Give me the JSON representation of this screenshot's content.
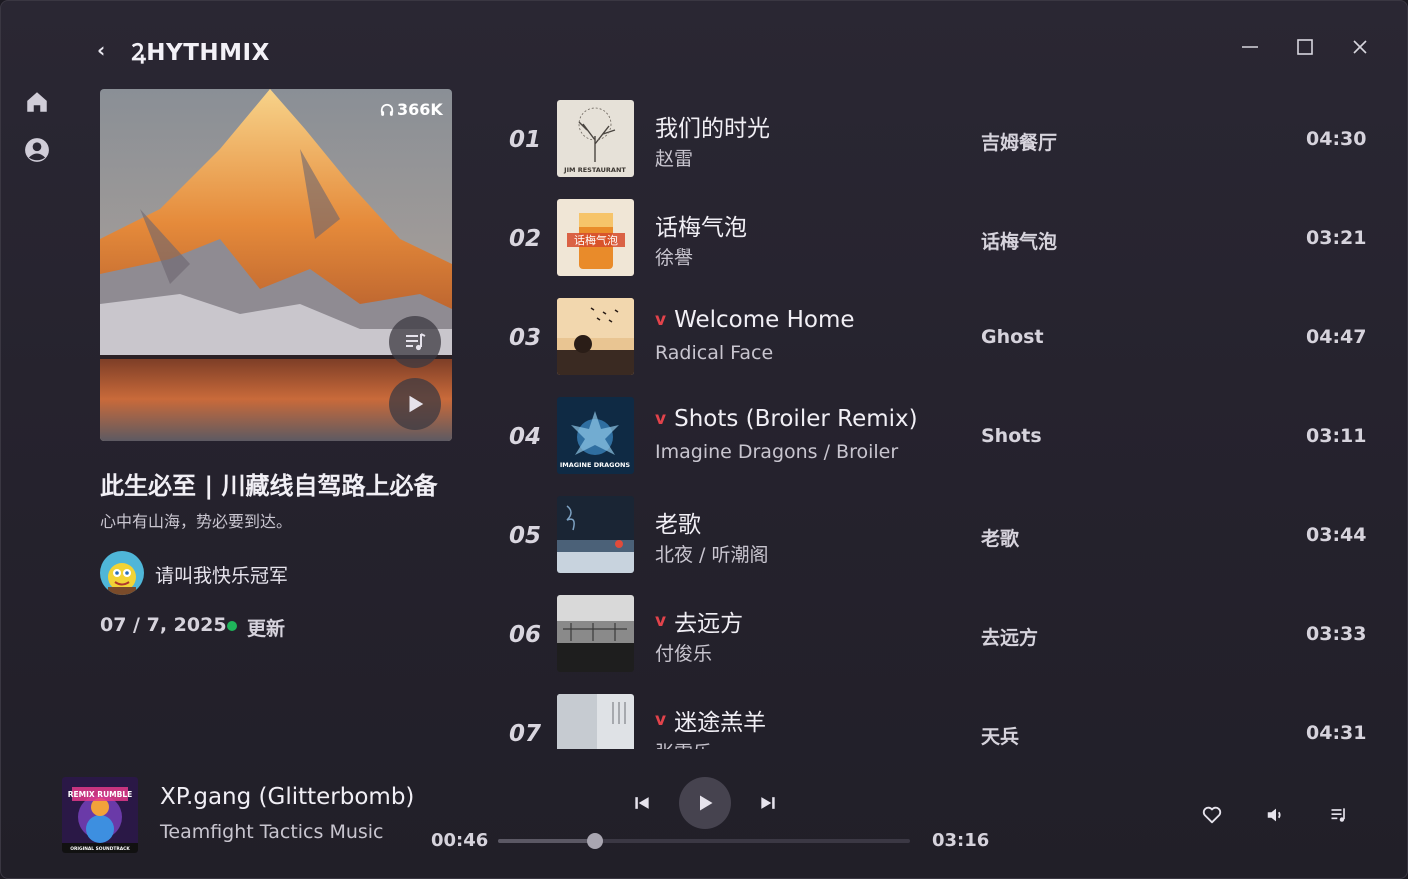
{
  "header": {
    "brand": "ꝜHYTHMIX",
    "back_glyph": "‹"
  },
  "playlist": {
    "listens": "366K",
    "title": "此生必至 | 川藏线自驾路上必备",
    "subtitle": "心中有山海，势必要到达。",
    "owner": "请叫我快乐冠军",
    "date": "07 / 7, 2025",
    "update_label": "更新"
  },
  "songs": [
    {
      "index": "01",
      "title": "我们的时光",
      "artist": "赵雷",
      "album": "吉姆餐厅",
      "duration": "04:30",
      "liked": false
    },
    {
      "index": "02",
      "title": "话梅气泡",
      "artist": "徐譽",
      "album": "话梅气泡",
      "duration": "03:21",
      "liked": false
    },
    {
      "index": "03",
      "title": "Welcome Home",
      "artist": "Radical Face",
      "album": "Ghost",
      "duration": "04:47",
      "liked": true
    },
    {
      "index": "04",
      "title": "Shots (Broiler Remix)",
      "artist": "Imagine Dragons / Broiler",
      "album": "Shots",
      "duration": "03:11",
      "liked": true
    },
    {
      "index": "05",
      "title": "老歌",
      "artist": "北夜 / 听潮阁",
      "album": "老歌",
      "duration": "03:44",
      "liked": false
    },
    {
      "index": "06",
      "title": "去远方",
      "artist": "付俊乐",
      "album": "去远方",
      "duration": "03:33",
      "liked": true
    },
    {
      "index": "07",
      "title": "迷途羔羊",
      "artist": "张雷乐",
      "album": "天兵",
      "duration": "04:31",
      "liked": true
    }
  ],
  "cover_text": {
    "album01": "JIM RESTAURANT",
    "album02": "话梅气泡",
    "album04": "IMAGINE DRAGONS"
  },
  "player": {
    "title": "XP.gang (Glitterbomb)",
    "artist": "Teamfight Tactics Music",
    "current": "00:46",
    "total": "03:16",
    "progress": 0.235,
    "art_text": "REMIX RUMBLE",
    "art_caption": "ORIGINAL SOUNDTRACK"
  },
  "colors": {
    "accent_like": "#e2434b",
    "update_dot": "#1fb45a",
    "background": "#25222d"
  },
  "icons": [
    "back-icon",
    "minimize-icon",
    "maximize-icon",
    "close-icon",
    "home-icon",
    "user-icon",
    "headphones-icon",
    "queue-icon",
    "play-icon",
    "previous-icon",
    "next-icon",
    "heart-icon",
    "volume-icon"
  ]
}
